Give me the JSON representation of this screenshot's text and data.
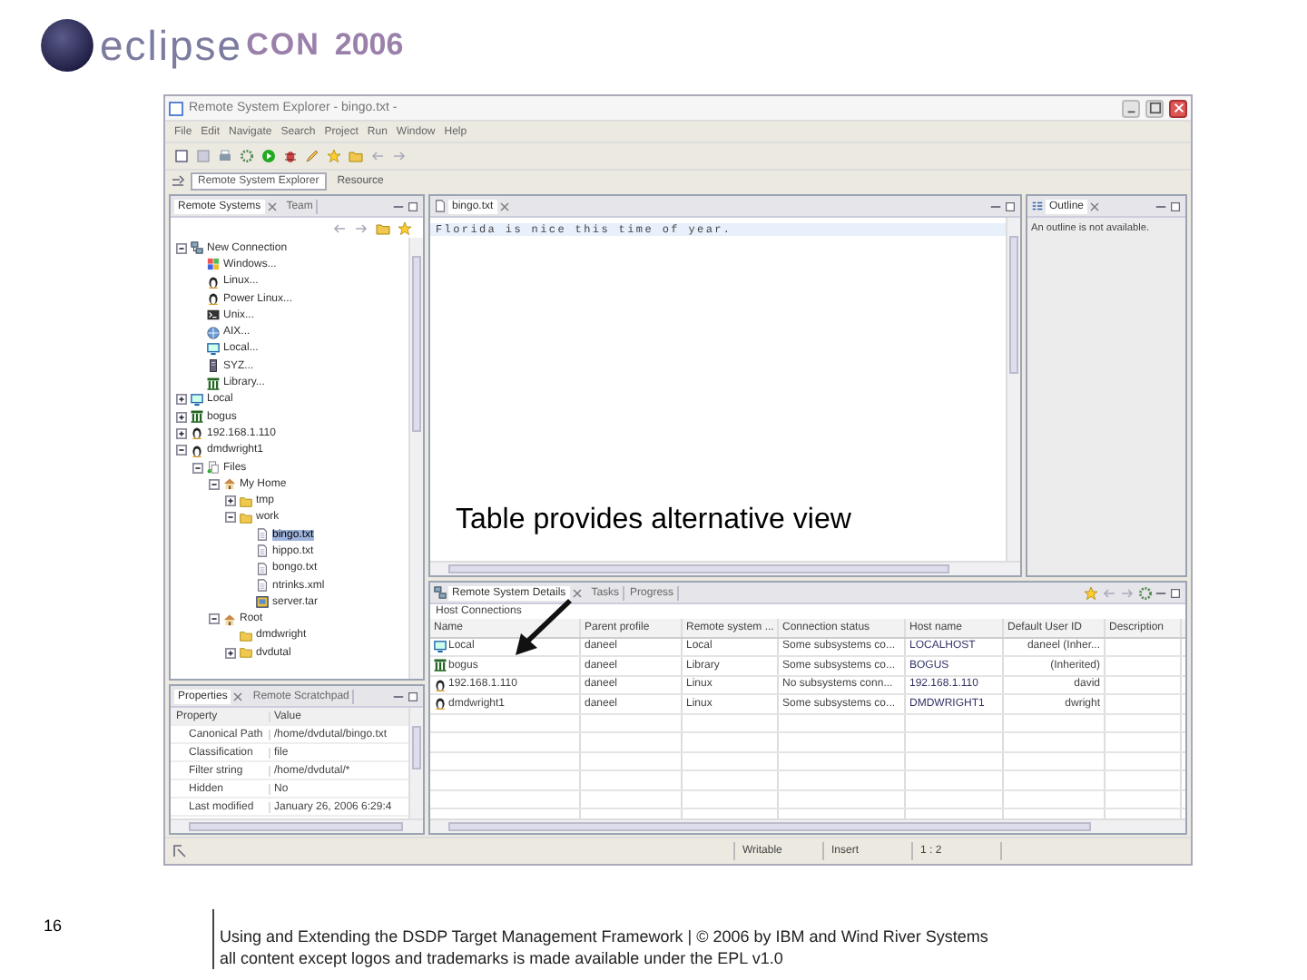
{
  "logo": {
    "word": "eclipse",
    "event": "CON",
    "year": "2006"
  },
  "window": {
    "title": "Remote System Explorer - bingo.txt -"
  },
  "menu": [
    "File",
    "Edit",
    "Navigate",
    "Search",
    "Project",
    "Run",
    "Window",
    "Help"
  ],
  "perspectives": [
    {
      "label": "Remote System Explorer",
      "selected": true
    },
    {
      "label": "Resource",
      "selected": false
    }
  ],
  "tree_view": {
    "tabs": [
      {
        "label": "Remote Systems",
        "selected": true
      },
      {
        "label": "Team",
        "selected": false
      }
    ],
    "items": [
      {
        "label": "New Connection",
        "kind": "connection-group",
        "expanded": true,
        "selected": false,
        "children": [
          {
            "label": "Windows...",
            "kind": "windows",
            "selected": false
          },
          {
            "label": "Linux...",
            "kind": "linux",
            "selected": false
          },
          {
            "label": "Power Linux...",
            "kind": "linux",
            "selected": false
          },
          {
            "label": "Unix...",
            "kind": "unix",
            "selected": false
          },
          {
            "label": "AIX...",
            "kind": "aix",
            "selected": false
          },
          {
            "label": "Local...",
            "kind": "local",
            "selected": false
          },
          {
            "label": "SYZ...",
            "kind": "server",
            "selected": false
          },
          {
            "label": "Library...",
            "kind": "library",
            "selected": false
          }
        ]
      },
      {
        "label": "Local",
        "kind": "local",
        "expanded": false,
        "selected": false
      },
      {
        "label": "bogus",
        "kind": "library",
        "expanded": false,
        "selected": false
      },
      {
        "label": "192.168.1.110",
        "kind": "linux",
        "expanded": false,
        "selected": false
      },
      {
        "label": "dmdwright1",
        "kind": "linux",
        "expanded": true,
        "selected": false,
        "children": [
          {
            "label": "Files",
            "kind": "files",
            "expanded": true,
            "selected": false,
            "children": [
              {
                "label": "My Home",
                "kind": "home",
                "expanded": true,
                "selected": false,
                "children": [
                  {
                    "label": "tmp",
                    "kind": "folder",
                    "expanded": false,
                    "selected": false
                  },
                  {
                    "label": "work",
                    "kind": "folder",
                    "expanded": true,
                    "selected": false,
                    "children": [
                      {
                        "label": "bingo.txt",
                        "kind": "file",
                        "selected": true
                      },
                      {
                        "label": "hippo.txt",
                        "kind": "file",
                        "selected": false
                      },
                      {
                        "label": "bongo.txt",
                        "kind": "file",
                        "selected": false
                      },
                      {
                        "label": "ntrinks.xml",
                        "kind": "file",
                        "selected": false
                      },
                      {
                        "label": "server.tar",
                        "kind": "archive",
                        "selected": false
                      }
                    ]
                  }
                ]
              },
              {
                "label": "Root",
                "kind": "home",
                "expanded": true,
                "selected": false,
                "children": [
                  {
                    "label": "dmdwright",
                    "kind": "folder",
                    "selected": false
                  },
                  {
                    "label": "dvdutal",
                    "kind": "folder",
                    "expanded": false,
                    "selected": false
                  }
                ]
              }
            ]
          }
        ]
      }
    ]
  },
  "properties_view": {
    "tabs": [
      {
        "label": "Properties",
        "selected": true
      },
      {
        "label": "Remote Scratchpad",
        "selected": false
      }
    ],
    "columns": [
      "Property",
      "Value"
    ],
    "rows": [
      {
        "property": "Canonical Path",
        "value": "/home/dvdutal/bingo.txt"
      },
      {
        "property": "Classification",
        "value": "file"
      },
      {
        "property": "Filter string",
        "value": "/home/dvdutal/*"
      },
      {
        "property": "Hidden",
        "value": "No"
      },
      {
        "property": "Last modified",
        "value": "January 26, 2006 6:29:4"
      }
    ]
  },
  "editor": {
    "tab": "bingo.txt",
    "lines": [
      "Florida is nice this time of year."
    ]
  },
  "outline": {
    "tab": "Outline",
    "message": "An outline is not available."
  },
  "details_view": {
    "tabs": [
      {
        "label": "Remote System Details",
        "selected": true
      },
      {
        "label": "Tasks",
        "selected": false
      },
      {
        "label": "Progress",
        "selected": false
      }
    ],
    "label": "Host Connections",
    "columns": [
      "Name",
      "Parent profile",
      "Remote system ...",
      "Connection status",
      "Host name",
      "Default User ID",
      "Description"
    ],
    "rows": [
      {
        "kind": "local",
        "cells": [
          "Local",
          "daneel",
          "Local",
          "Some subsystems co...",
          "LOCALHOST",
          "daneel (Inher..."
        ]
      },
      {
        "kind": "library",
        "cells": [
          "bogus",
          "daneel",
          "Library",
          "Some subsystems co...",
          "BOGUS",
          "(Inherited)"
        ]
      },
      {
        "kind": "linux",
        "cells": [
          "192.168.1.110",
          "daneel",
          "Linux",
          "No subsystems conn...",
          "192.168.1.110",
          "david"
        ]
      },
      {
        "kind": "linux",
        "cells": [
          "dmdwright1",
          "daneel",
          "Linux",
          "Some subsystems co...",
          "DMDWRIGHT1",
          "dwright"
        ]
      }
    ]
  },
  "status_bar": [
    "Writable",
    "Insert",
    "1 : 2"
  ],
  "annotation": "Table provides alternative view",
  "footer": {
    "page": "16",
    "lines": [
      "Using and Extending the DSDP Target Management Framework | © 2006 by IBM and Wind River Systems",
      "all content except logos and trademarks is made available under the EPL v1.0"
    ]
  }
}
